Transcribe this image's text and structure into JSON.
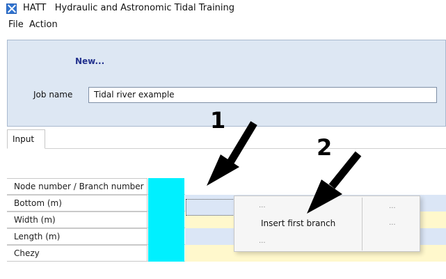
{
  "window": {
    "app_short": "HATT",
    "title": "Hydraulic and Astronomic Tidal Training"
  },
  "menu": {
    "file": "File",
    "action": "Action"
  },
  "header": {
    "new_label": "New...",
    "job_name_label": "Job name",
    "job_name_value": "Tidal river example"
  },
  "tabs": {
    "input": "Input"
  },
  "table": {
    "rows": [
      {
        "label": "Node number / Branch number",
        "fill": "white"
      },
      {
        "label": "Bottom (m)",
        "fill": "blue"
      },
      {
        "label": "Width (m)",
        "fill": "yellow"
      },
      {
        "label": "Length (m)",
        "fill": "blue"
      },
      {
        "label": "Chezy",
        "fill": "yellow"
      }
    ]
  },
  "context_menu": {
    "left_top": "...",
    "insert_first_branch": "Insert first branch",
    "left_bottom": "...",
    "right_top": "...",
    "right_middle": "..."
  },
  "callouts": {
    "one": "1",
    "two": "2"
  },
  "colors": {
    "node_cell": "#00f0ff",
    "header_panel": "#dde7f3",
    "blue_row": "#dbe6f6",
    "yellow_row": "#fff8cc"
  }
}
